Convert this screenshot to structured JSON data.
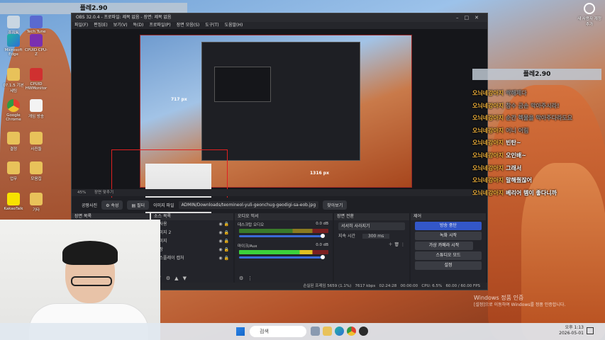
{
  "stream_title": "플레2.90",
  "top_banner": "플레2.90",
  "desktop": {
    "icons": [
      {
        "label": "휴지통"
      },
      {
        "label": "Microsoft Edge"
      },
      {
        "label": "07.1.5 기본 세팅"
      },
      {
        "label": "Google Chrome"
      },
      {
        "label": "결정"
      },
      {
        "label": "업무"
      },
      {
        "label": "KakaoTalk"
      },
      {
        "label": "Tech Tune"
      },
      {
        "label": "CPUID CPU-Z"
      },
      {
        "label": "CPUID HWMonitor"
      },
      {
        "label": "게임 방송"
      },
      {
        "label": "사진들"
      },
      {
        "label": "모음집"
      },
      {
        "label": "기타"
      }
    ],
    "corner_icon_label": "새 사용자 계정 추가"
  },
  "obs": {
    "title": "OBS 32.0.4 - 프로파일: 제목 없음 - 장면: 제목 없음",
    "menu": [
      "파일(F)",
      "편집(E)",
      "보기(V)",
      "독(D)",
      "프로파일(P)",
      "장면 모음(S)",
      "도구(T)",
      "도움말(H)"
    ],
    "preview_labels": {
      "height": "717 px",
      "width": "1316 px"
    },
    "zoom": "45%",
    "status_strip_text": "장면 맞추기",
    "props_bar": {
      "source_name": "공팡사진",
      "properties": "속성",
      "filters": "필터",
      "image_file_label": "이미지 파일",
      "path": "ADMIN/Downloads/teomineol-yuli-geonchug-geodigi-sa-eob.jpg",
      "browse": "찾아보기"
    },
    "docks": {
      "scenes": {
        "title": "장면 목록"
      },
      "sources": {
        "title": "소스 목록",
        "items": [
          "색사용",
          "이미지 2",
          "이미지",
          "홍장",
          "디스플레이 캡처"
        ]
      },
      "mixer": {
        "title": "오디오 믹서",
        "channels": [
          {
            "name": "데스크탑 오디오",
            "db": "0.0 dB"
          },
          {
            "name": "마이크/Aux",
            "db": "0.0 dB"
          }
        ]
      },
      "transitions": {
        "title": "장면 전환",
        "type": "서서히 사라지기",
        "duration_label": "지속 시간",
        "duration_value": "300 ms"
      },
      "controls": {
        "title": "제어",
        "buttons": [
          "방송 중단",
          "녹화 시작",
          "가상 카메라 시작",
          "스튜디오 모드",
          "설정"
        ]
      }
    },
    "status_bar": {
      "dropped": "손실된 프레임 5659 (1.1%)",
      "bitrate": "7617 kbps",
      "stream_time": "02:24:28",
      "rec_time": "00:00:00",
      "cpu": "CPU: 6.5%",
      "fps": "60.00 / 60.00 FPS"
    }
  },
  "chat": {
    "messages": [
      {
        "user": "오늬네강아지",
        "text": "싹해제다"
      },
      {
        "user": "오늬네강아지",
        "text": "참수 금손 막아주시라!"
      },
      {
        "user": "오늬네강아지",
        "text": "순간 헥물을 막아주다라도요"
      },
      {
        "user": "오늬네강아지",
        "text": "어니 어림"
      },
      {
        "user": "오늬네강아지",
        "text": "빈탄~"
      },
      {
        "user": "오늬네강아지",
        "text": "오인배~"
      },
      {
        "user": "오늬네강아지",
        "text": "그래서"
      },
      {
        "user": "오늬네강아지",
        "text": "말해줬잖어"
      },
      {
        "user": "오늬네강아지",
        "text": "베리어 템이 좋다니까"
      }
    ]
  },
  "activation": {
    "line1": "Windows 정품 인증",
    "line2": "[설정]으로 이동하여 Windows를 정품 인증합니다."
  },
  "taskbar": {
    "search_placeholder": "검색",
    "time": "오후 1:13",
    "date": "2026-05-01"
  }
}
